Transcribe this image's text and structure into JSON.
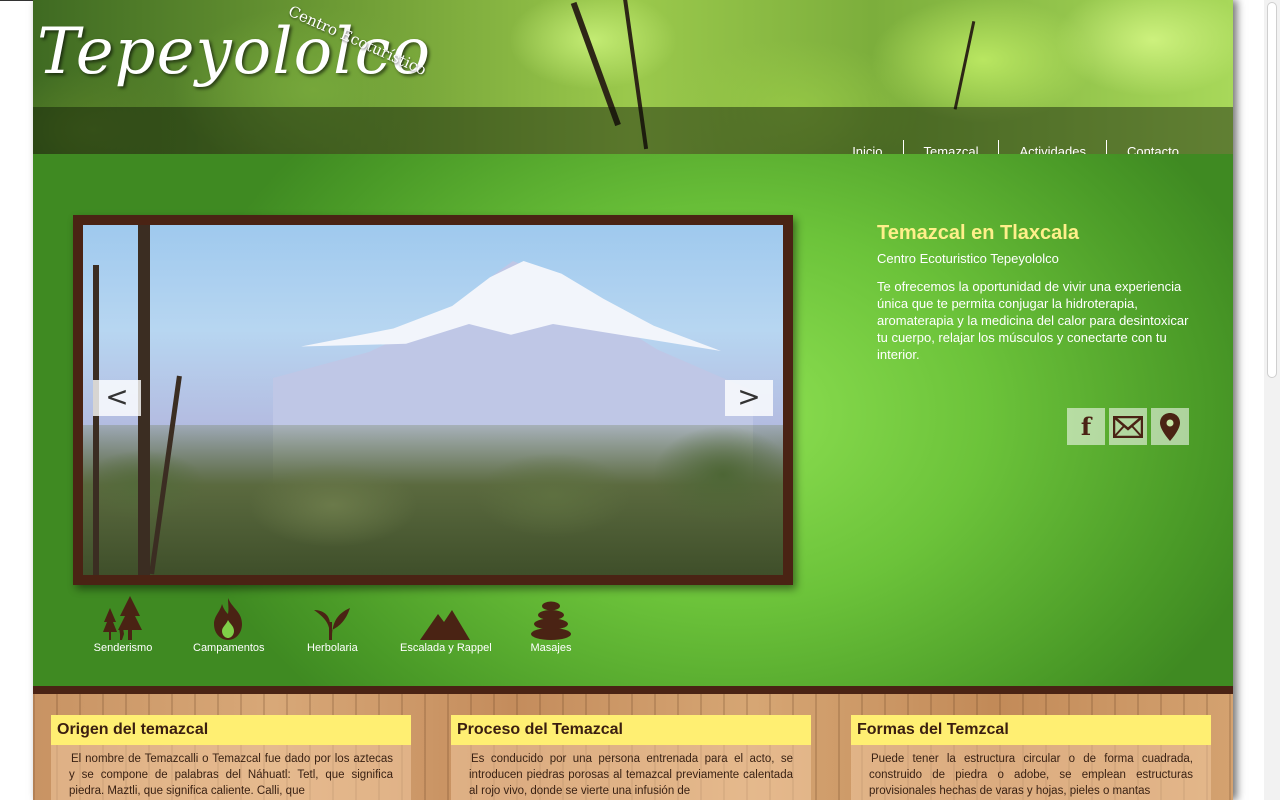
{
  "site": {
    "logo_text": "Tepeyololco",
    "logo_tagline": "Centro Ecoturístico"
  },
  "nav": {
    "items": [
      "Inicio",
      "Temazcal",
      "Actividades",
      "Contacto"
    ]
  },
  "slider": {
    "prev_label": "<",
    "next_label": ">"
  },
  "hero": {
    "title": "Temazcal en Tlaxcala",
    "subtitle": "Centro Ecoturistico Tepeyololco",
    "description": "Te ofrecemos la oportunidad de vivir una experiencia única que te permita conjugar la hidroterapia, aromaterapia y la medicina del calor para desintoxicar tu cuerpo, relajar los músculos y conectarte con tu interior."
  },
  "social": {
    "facebook_glyph": "f",
    "icons": [
      "facebook-icon",
      "mail-icon",
      "map-pin-icon"
    ]
  },
  "activities": [
    "Senderismo",
    "Campamentos",
    "Herbolaria",
    "Escalada y Rappel",
    "Masajes"
  ],
  "cards": [
    {
      "title": "Origen del temazcal",
      "text": "El nombre de Temazcalli o Temazcal fue dado por los aztecas y se compone de palabras del Náhuatl: Tetl, que significa piedra. Maztli, que significa caliente. Calli, que"
    },
    {
      "title": "Proceso del Temazcal",
      "text": "Es conducido por una persona entrenada para el acto, se introducen piedras porosas al temazcal previamente calentada al rojo vivo, donde se vierte una infusión de"
    },
    {
      "title": "Formas del Temzcal",
      "text": "Puede tener la estructura circular o de forma cuadrada, construido de piedra o adobe, se emplean estructuras provisionales hechas de varas y hojas, pieles o mantas"
    }
  ],
  "colors": {
    "brown": "#4a2314",
    "yellow_title": "#ffef8a",
    "card_header": "#ffef72",
    "green": "#6cc33a"
  }
}
